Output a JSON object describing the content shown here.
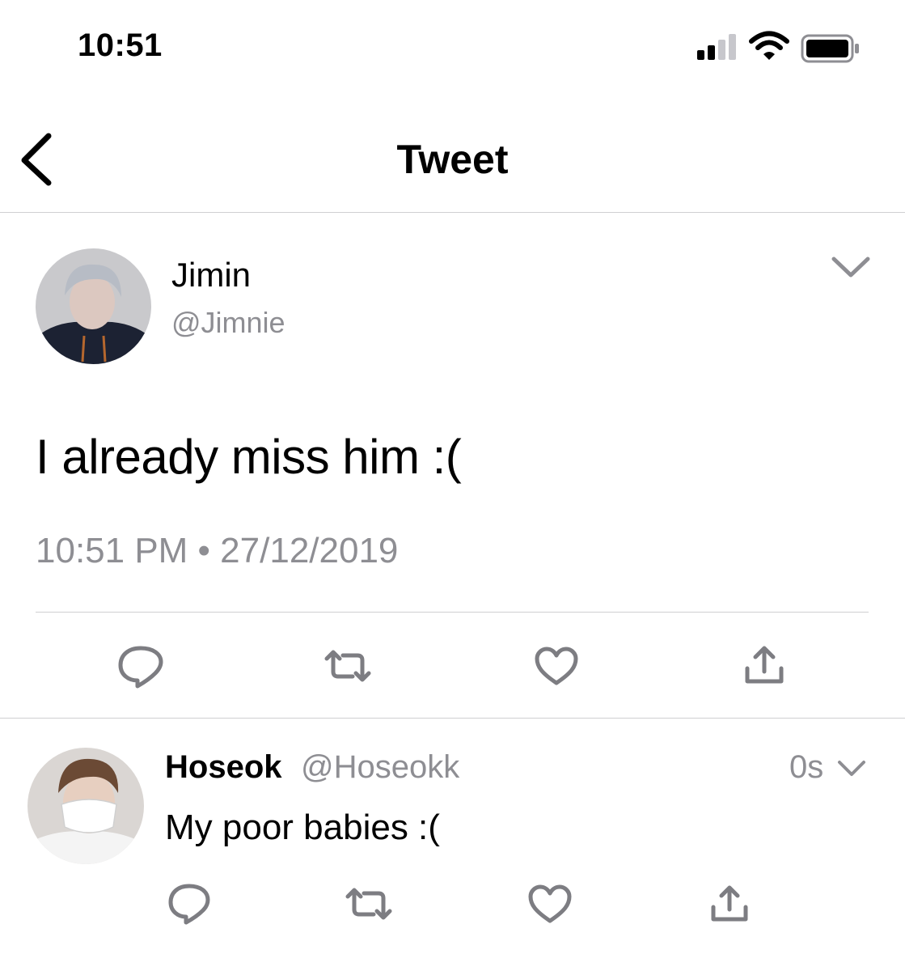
{
  "status_bar": {
    "time": "10:51",
    "icons": [
      "signal-icon",
      "wifi-icon",
      "battery-icon"
    ]
  },
  "nav": {
    "title": "Tweet",
    "back_icon": "back-chevron-icon"
  },
  "tweet": {
    "author_name": "Jimin",
    "author_handle": "@Jimnie",
    "text": "I already miss him :(",
    "meta": "10:51 PM • 27/12/2019",
    "actions": [
      "reply-icon",
      "retweet-icon",
      "like-icon",
      "share-icon"
    ]
  },
  "reply": {
    "author_name": "Hoseok",
    "author_handle": "@Hoseokk",
    "time": "0s",
    "text": "My poor babies :(",
    "actions": [
      "reply-icon",
      "retweet-icon",
      "like-icon",
      "share-icon"
    ]
  },
  "colors": {
    "icon": "#7d7d82",
    "secondary_text": "#8e8e93",
    "divider": "#cfcfd2"
  }
}
